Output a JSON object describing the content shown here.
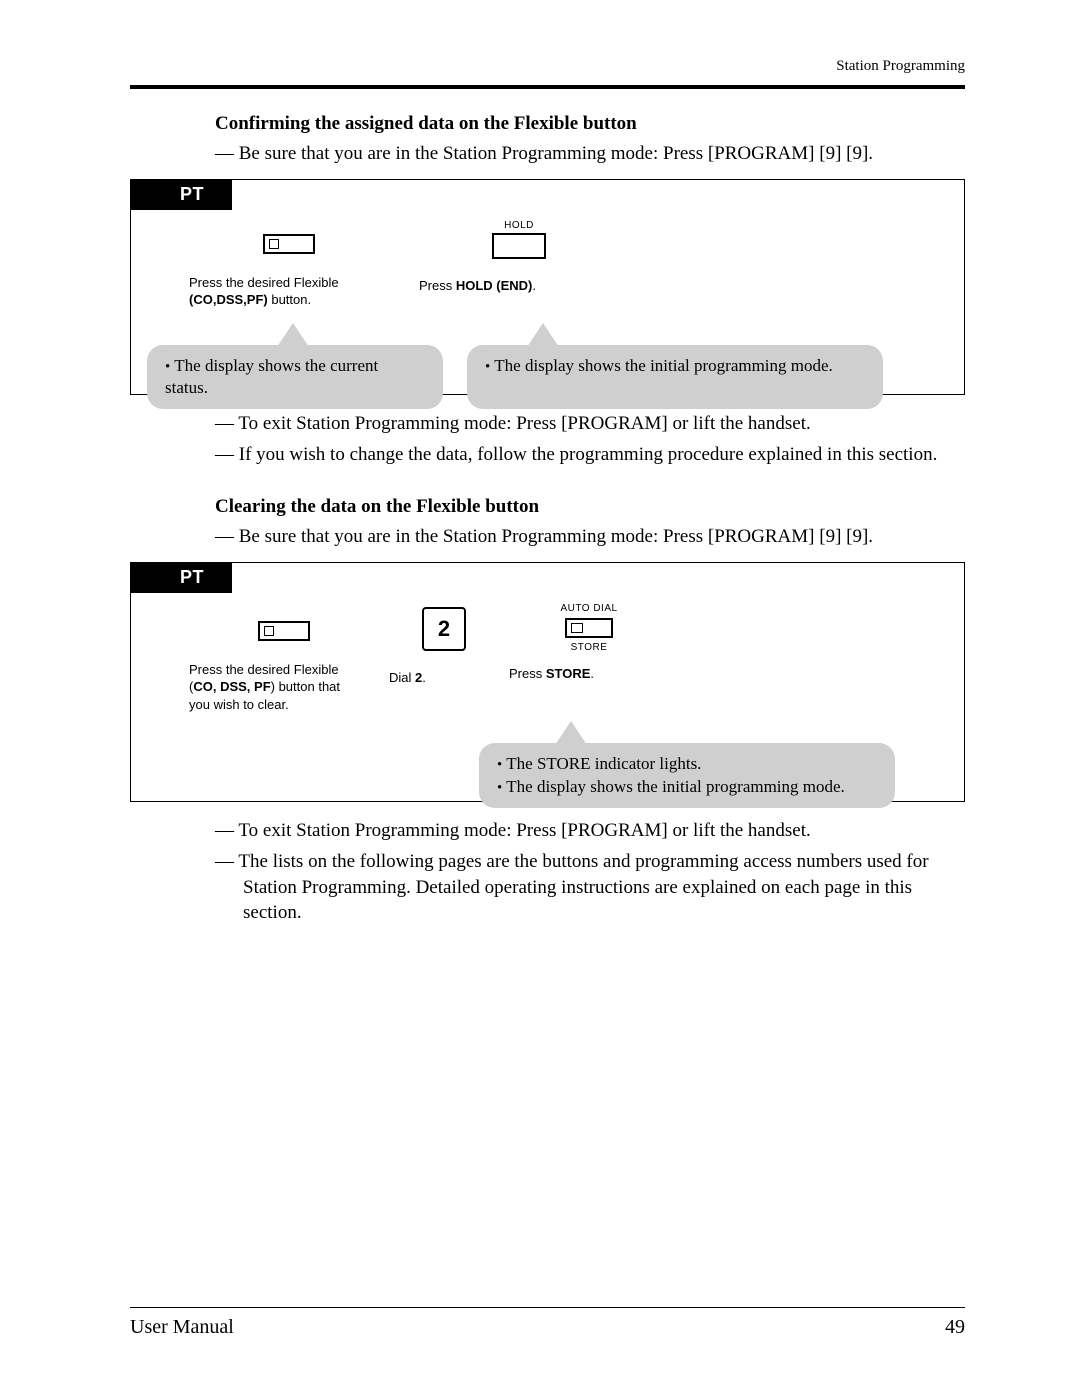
{
  "header": {
    "running_title": "Station Programming"
  },
  "section1": {
    "heading": "Confirming the assigned data on the Flexible button",
    "line1": "— Be sure that you are in the Station Programming mode: Press [PROGRAM] [9] [9].",
    "pt_label": "PT",
    "hold_small_label": "HOLD",
    "step_a_text_1": "Press the desired Flexible",
    "step_a_text_2a": "(CO,DSS,PF)",
    "step_a_text_2b": " button.",
    "step_b_text_1": "Press ",
    "step_b_text_2": "HOLD (END)",
    "step_b_text_3": ".",
    "callout_a": "The display shows the current status.",
    "callout_b": "The display shows the initial programming mode.",
    "after_line1": "— To exit Station Programming mode: Press [PROGRAM] or lift the handset.",
    "after_line2": "— If you wish to change the data, follow the programming procedure explained in this section."
  },
  "section2": {
    "heading": "Clearing the data on the Flexible button",
    "line1": "— Be sure that you are in the Station Programming mode: Press [PROGRAM] [9] [9].",
    "pt_label": "PT",
    "dial_key": "2",
    "auto_dial_label": "AUTO DIAL",
    "store_label": "STORE",
    "step_a_text_1": "Press the desired Flexible",
    "step_a_text_2a": "(",
    "step_a_text_2b": "CO, DSS, PF",
    "step_a_text_2c": ") button that",
    "step_a_text_3": "you wish to clear.",
    "step_b_text_1": "Dial ",
    "step_b_text_2": "2",
    "step_b_text_3": ".",
    "step_c_text_1": "Press ",
    "step_c_text_2": "STORE",
    "step_c_text_3": ".",
    "callout_line1": "The STORE indicator lights.",
    "callout_line2": "The display shows the initial programming mode.",
    "after_line1": "— To exit Station Programming mode: Press [PROGRAM] or lift the handset.",
    "after_line2": "— The lists on the following pages are the buttons and programming access numbers used for Station Programming. Detailed operating instructions are explained on each page in this section."
  },
  "footer": {
    "left": "User Manual",
    "right": "49"
  }
}
